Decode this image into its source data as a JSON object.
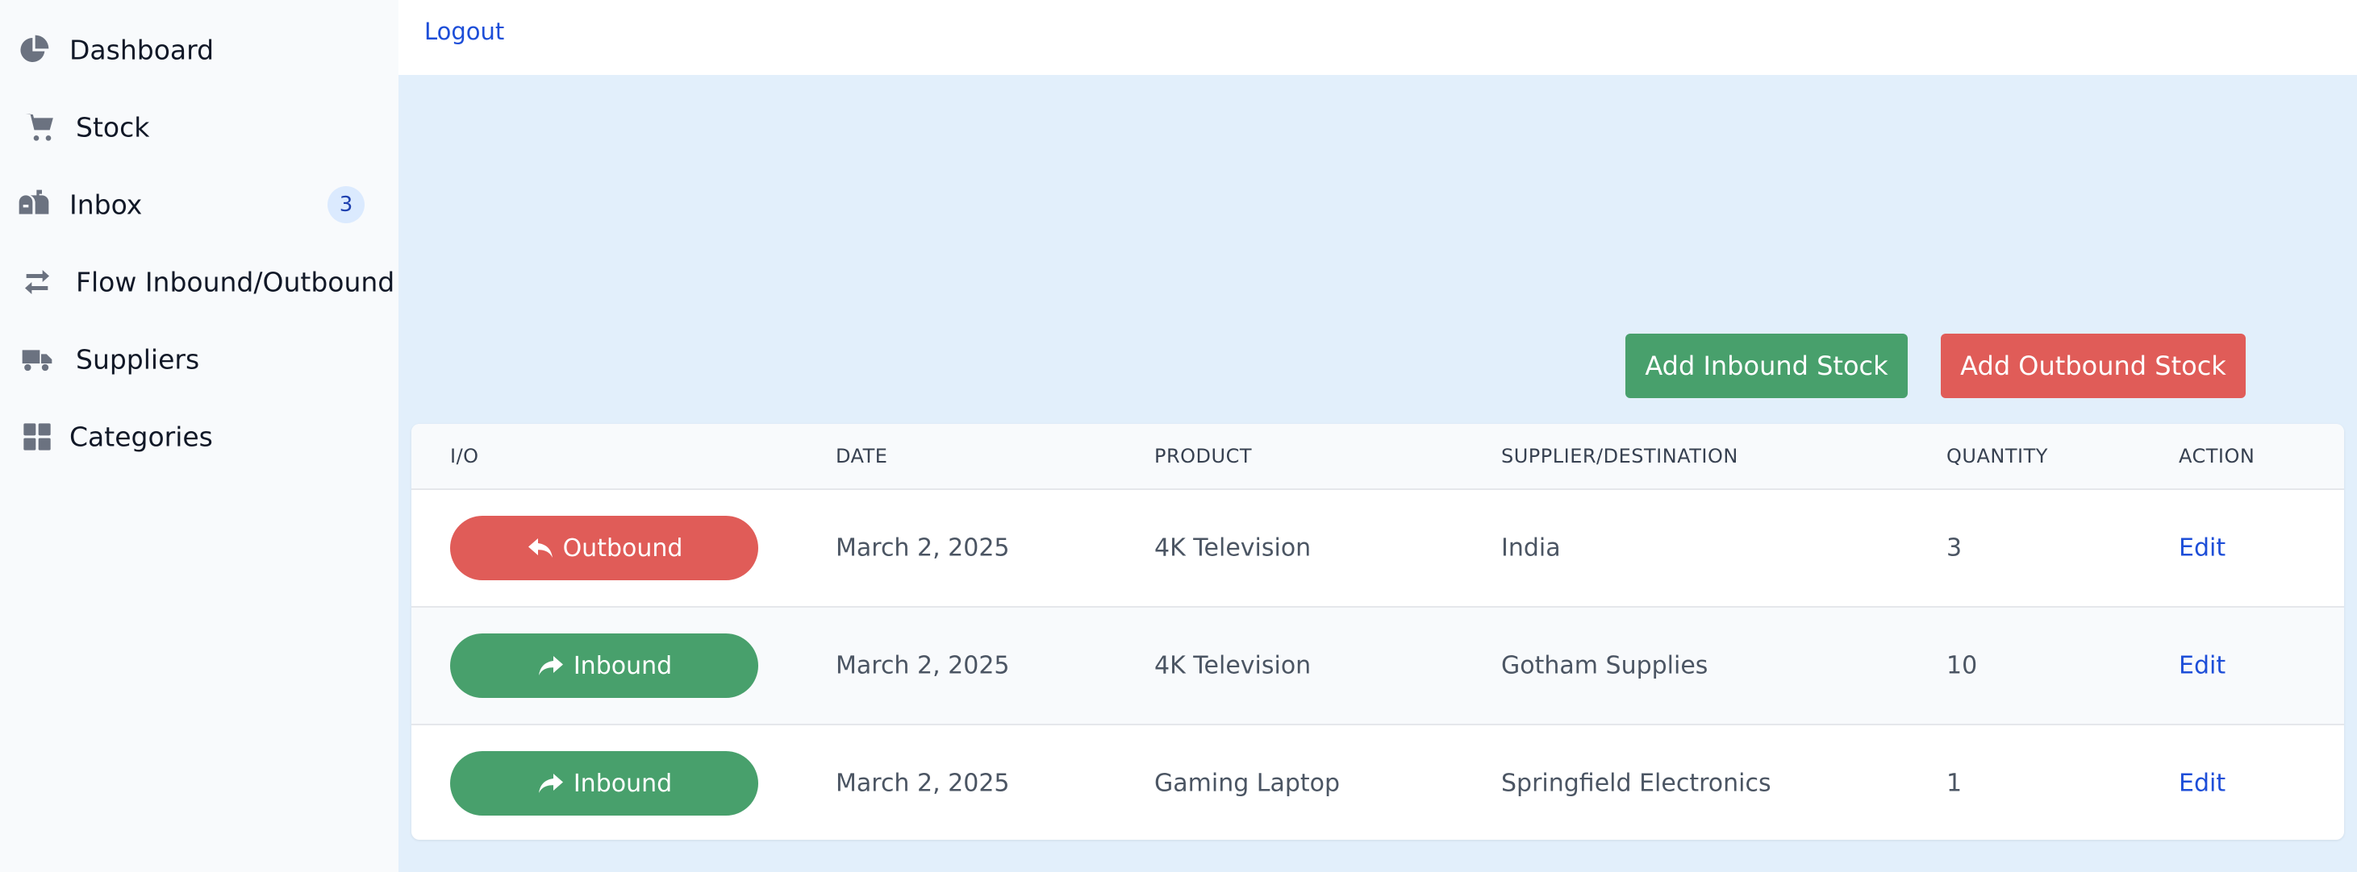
{
  "sidebar": {
    "items": [
      {
        "label": "Dashboard",
        "icon": "pie-chart-icon"
      },
      {
        "label": "Stock",
        "icon": "cart-icon"
      },
      {
        "label": "Inbox",
        "icon": "mailbox-icon",
        "badge": "3"
      },
      {
        "label": "Flow Inbound/Outbound",
        "icon": "arrows-swap-icon"
      },
      {
        "label": "Suppliers",
        "icon": "truck-icon"
      },
      {
        "label": "Categories",
        "icon": "grid-icon"
      }
    ]
  },
  "topbar": {
    "logout_label": "Logout"
  },
  "actions": {
    "add_inbound_label": "Add Inbound Stock",
    "add_outbound_label": "Add Outbound Stock"
  },
  "table": {
    "headers": [
      "I/O",
      "DATE",
      "PRODUCT",
      "SUPPLIER/DESTINATION",
      "QUANTITY",
      "ACTION"
    ],
    "rows": [
      {
        "io": "Outbound",
        "date": "March 2, 2025",
        "product": "4K Television",
        "party": "India",
        "quantity": "3",
        "action": "Edit"
      },
      {
        "io": "Inbound",
        "date": "March 2, 2025",
        "product": "4K Television",
        "party": "Gotham Supplies",
        "quantity": "10",
        "action": "Edit"
      },
      {
        "io": "Inbound",
        "date": "March 2, 2025",
        "product": "Gaming Laptop",
        "party": "Springfield Electronics",
        "quantity": "1",
        "action": "Edit"
      }
    ]
  },
  "colors": {
    "inbound": "#48a06c",
    "outbound": "#e05c58",
    "link": "#1d4ed8",
    "background": "#e2effb"
  }
}
